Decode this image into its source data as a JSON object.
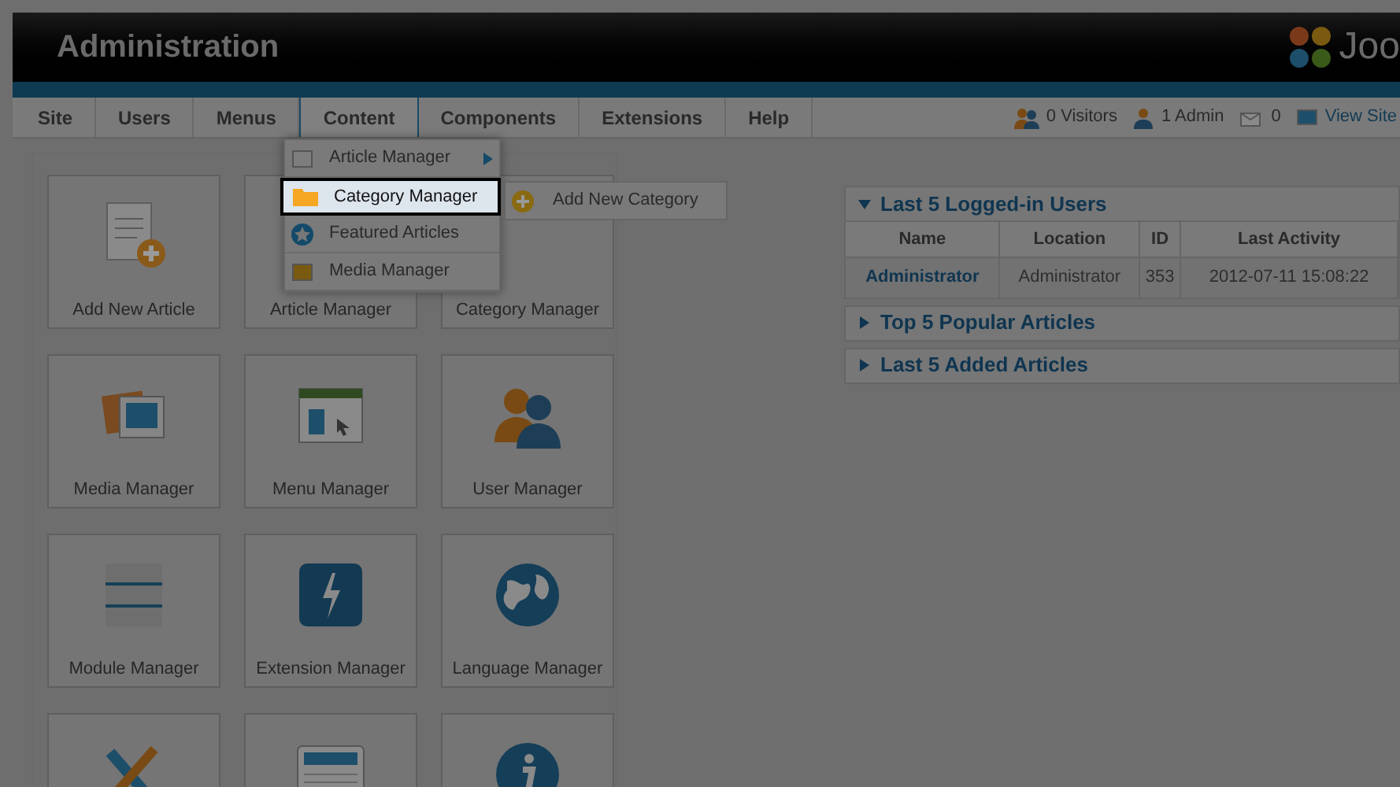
{
  "header": {
    "title": "Administration",
    "logo_text": "Joo"
  },
  "menu": [
    {
      "label": "Site",
      "selected": false
    },
    {
      "label": "Users",
      "selected": false
    },
    {
      "label": "Menus",
      "selected": false
    },
    {
      "label": "Content",
      "selected": true
    },
    {
      "label": "Components",
      "selected": false
    },
    {
      "label": "Extensions",
      "selected": false
    },
    {
      "label": "Help",
      "selected": false
    }
  ],
  "status": [
    {
      "kind": "visitors",
      "text": "0 Visitors"
    },
    {
      "kind": "admin",
      "text": "1 Admin"
    },
    {
      "kind": "messages",
      "text": "0"
    },
    {
      "kind": "site",
      "text": "View Site"
    }
  ],
  "dropdown": {
    "items": [
      {
        "label": "Article Manager",
        "kind": "article",
        "has_submenu": true,
        "selected": false
      },
      {
        "label": "Category Manager",
        "kind": "folder",
        "has_submenu": false,
        "selected": true
      },
      {
        "label": "Featured Articles",
        "kind": "star",
        "has_submenu": false,
        "selected": false
      },
      {
        "label": "Media Manager",
        "kind": "media",
        "has_submenu": false,
        "selected": false
      }
    ],
    "submenu": [
      {
        "label": "Add New Category",
        "kind": "plus"
      }
    ]
  },
  "tiles": [
    {
      "label": "Add New Article",
      "kind": "article-add"
    },
    {
      "label": "Article Manager",
      "kind": "covered"
    },
    {
      "label": "Category Manager",
      "kind": "covered"
    },
    {
      "label": "Media Manager",
      "kind": "media"
    },
    {
      "label": "Menu Manager",
      "kind": "menu"
    },
    {
      "label": "User Manager",
      "kind": "user"
    },
    {
      "label": "Module Manager",
      "kind": "module"
    },
    {
      "label": "Extension Manager",
      "kind": "extension"
    },
    {
      "label": "Language Manager",
      "kind": "globe"
    },
    {
      "kind": "tools"
    },
    {
      "kind": "document"
    },
    {
      "kind": "info"
    }
  ],
  "panels": [
    {
      "title": "Last 5 Logged-in Users",
      "expanded": true,
      "table": {
        "columns": [
          "Name",
          "Location",
          "ID",
          "Last Activity"
        ],
        "rows": [
          [
            "Administrator",
            "Administrator",
            "353",
            "2012-07-11 15:08:22"
          ]
        ]
      }
    },
    {
      "title": "Top 5 Popular Articles",
      "expanded": false
    },
    {
      "title": "Last 5 Added Articles",
      "expanded": false
    }
  ]
}
